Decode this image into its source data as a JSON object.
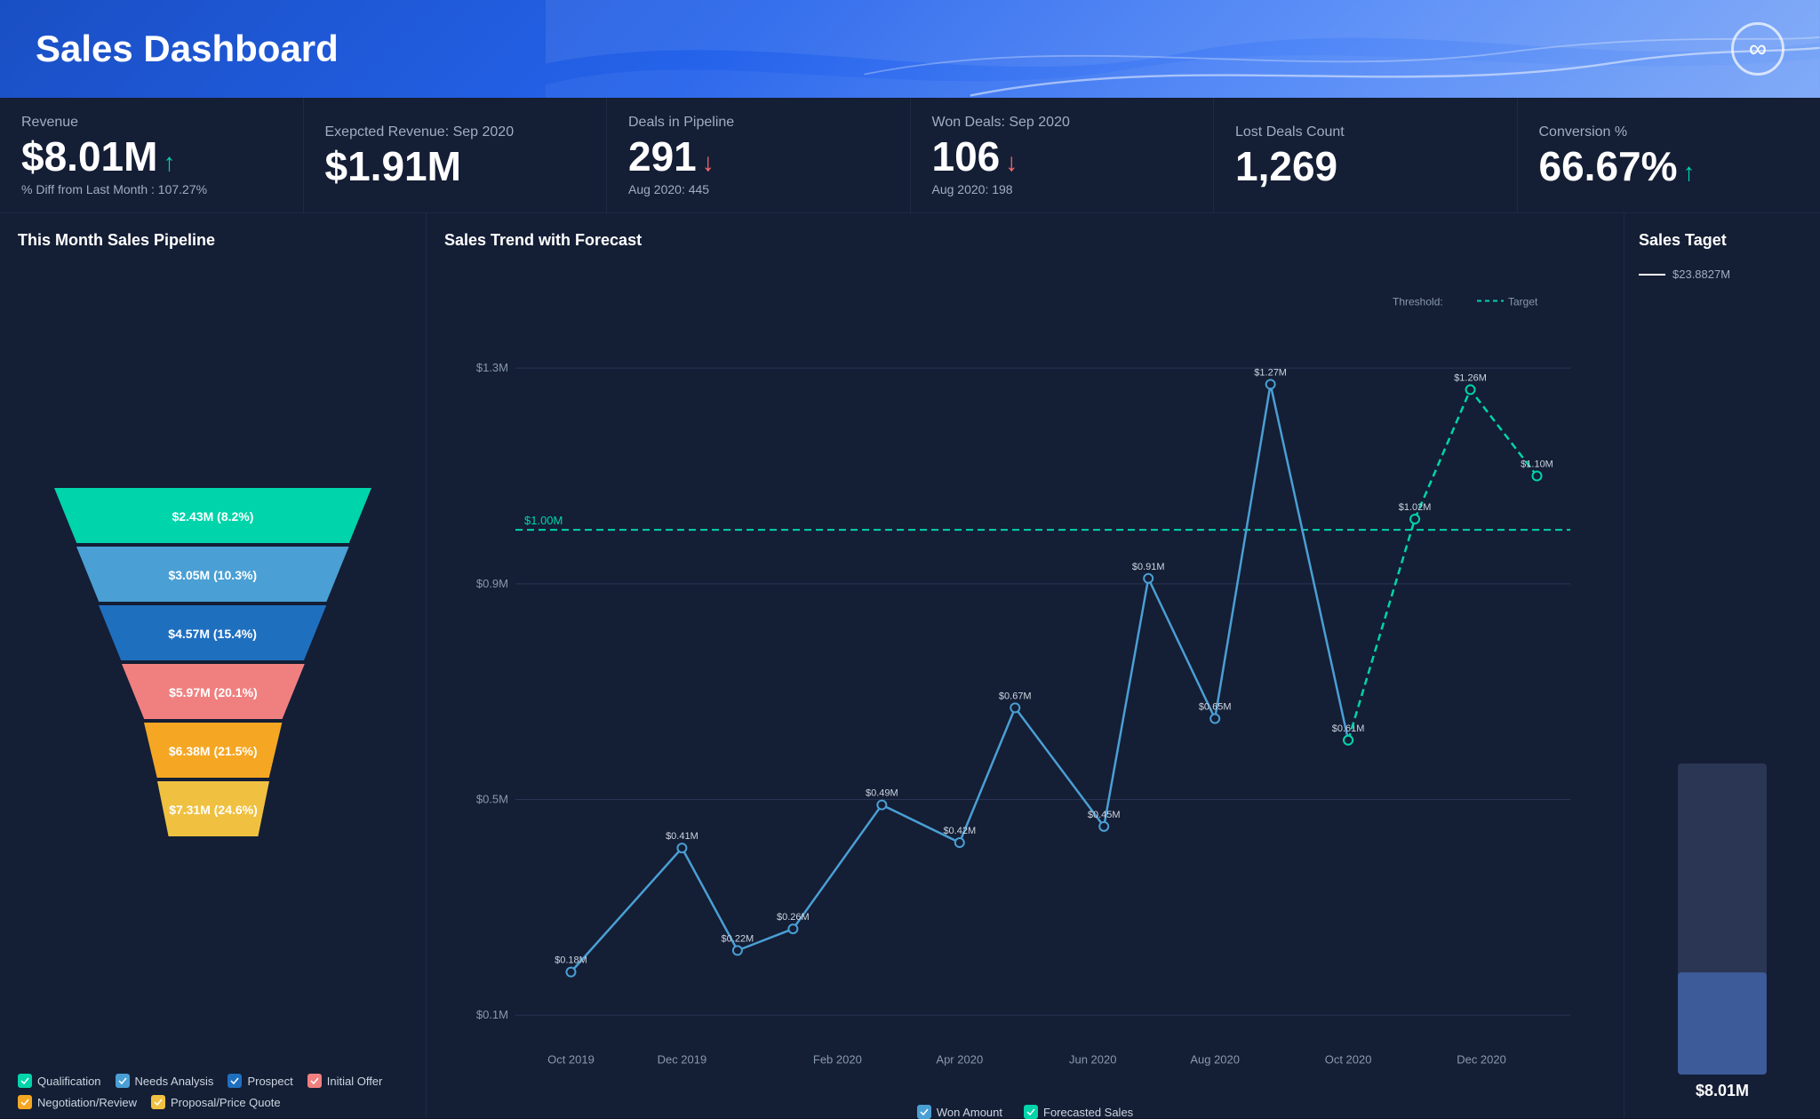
{
  "header": {
    "title": "Sales Dashboard",
    "logo_icon": "∞"
  },
  "kpis": [
    {
      "label": "Revenue",
      "value": "$8.01M",
      "arrow": "↑",
      "arrow_type": "up",
      "sub": "% Diff from Last Month : 107.27%"
    },
    {
      "label": "Exepcted Revenue: Sep 2020",
      "value": "$1.91M",
      "arrow": "",
      "arrow_type": "",
      "sub": ""
    },
    {
      "label": "Deals in Pipeline",
      "value": "291",
      "arrow": "↓",
      "arrow_type": "down",
      "sub": "Aug 2020: 445"
    },
    {
      "label": "Won Deals: Sep 2020",
      "value": "106",
      "arrow": "↓",
      "arrow_type": "down",
      "sub": "Aug 2020: 198"
    },
    {
      "label": "Lost Deals Count",
      "value": "1,269",
      "arrow": "",
      "arrow_type": "",
      "sub": ""
    },
    {
      "label": "Conversion %",
      "value": "66.67%",
      "arrow": "↑",
      "arrow_type": "up",
      "sub": ""
    }
  ],
  "funnel": {
    "title": "This Month Sales Pipeline",
    "segments": [
      {
        "label": "$2.43M (8.2%)",
        "color": "#00d4aa",
        "width_pct": 85
      },
      {
        "label": "$3.05M (10.3%)",
        "color": "#4a9fd4",
        "width_pct": 73
      },
      {
        "label": "$4.57M (15.4%)",
        "color": "#1f6fbf",
        "width_pct": 61
      },
      {
        "label": "$5.97M (20.1%)",
        "color": "#f08080",
        "width_pct": 49
      },
      {
        "label": "$6.38M (21.5%)",
        "color": "#f5a623",
        "width_pct": 37
      },
      {
        "label": "$7.31M (24.6%)",
        "color": "#f0c040",
        "width_pct": 30
      }
    ],
    "legend": [
      {
        "label": "Qualification",
        "color": "#00d4aa"
      },
      {
        "label": "Needs Analysis",
        "color": "#4a9fd4"
      },
      {
        "label": "Prospect",
        "color": "#1f6fbf"
      },
      {
        "label": "Initial Offer",
        "color": "#f08080"
      },
      {
        "label": "Negotiation/Review",
        "color": "#f5a623"
      },
      {
        "label": "Proposal/Price Quote",
        "color": "#f0c040"
      }
    ]
  },
  "chart": {
    "title": "Sales Trend with Forecast",
    "threshold_label": "Threshold:",
    "target_label": "Target",
    "threshold_value": "$1.00M",
    "x_labels": [
      "Oct 2019",
      "Dec 2019",
      "Feb 2020",
      "Apr 2020",
      "Jun 2020",
      "Aug 2020",
      "Oct 2020",
      "Dec 2020"
    ],
    "y_labels": [
      "$0.1M",
      "$0.5M",
      "$0.9M",
      "$1.3M"
    ],
    "won_points": [
      {
        "x": 0,
        "y": 0.18,
        "label": "$0.18M"
      },
      {
        "x": 1,
        "y": 0.41,
        "label": "$0.41M"
      },
      {
        "x": 2,
        "y": 0.22,
        "label": "$0.22M"
      },
      {
        "x": 3,
        "y": 0.26,
        "label": "$0.26M"
      },
      {
        "x": 3.4,
        "y": 0.49,
        "label": "$0.49M"
      },
      {
        "x": 4,
        "y": 0.42,
        "label": "$0.42M"
      },
      {
        "x": 4.5,
        "y": 0.67,
        "label": "$0.67M"
      },
      {
        "x": 5,
        "y": 0.45,
        "label": "$0.45M"
      },
      {
        "x": 5.5,
        "y": 0.91,
        "label": "$0.91M"
      },
      {
        "x": 6,
        "y": 0.65,
        "label": "$0.65M"
      },
      {
        "x": 6.5,
        "y": 1.27,
        "label": "$1.27M"
      },
      {
        "x": 7,
        "y": 0.61,
        "label": "$0.61M"
      }
    ],
    "forecast_points": [
      {
        "x": 7,
        "y": 0.61,
        "label": "$0.61M"
      },
      {
        "x": 7.5,
        "y": 1.02,
        "label": "$1.02M"
      },
      {
        "x": 8,
        "y": 1.26,
        "label": "$1.26M"
      },
      {
        "x": 8.5,
        "y": 1.1,
        "label": "$1.10M"
      }
    ],
    "legend": [
      {
        "label": "Won Amount",
        "color": "#4a9fd4",
        "border_color": "#4a9fd4"
      },
      {
        "label": "Forecasted Sales",
        "color": "#00d4aa",
        "border_color": "#00d4aa"
      }
    ]
  },
  "target": {
    "title": "Sales Taget",
    "line_value": "$23.8827M",
    "bar_value": "$8.01M",
    "fill_pct": 33
  }
}
